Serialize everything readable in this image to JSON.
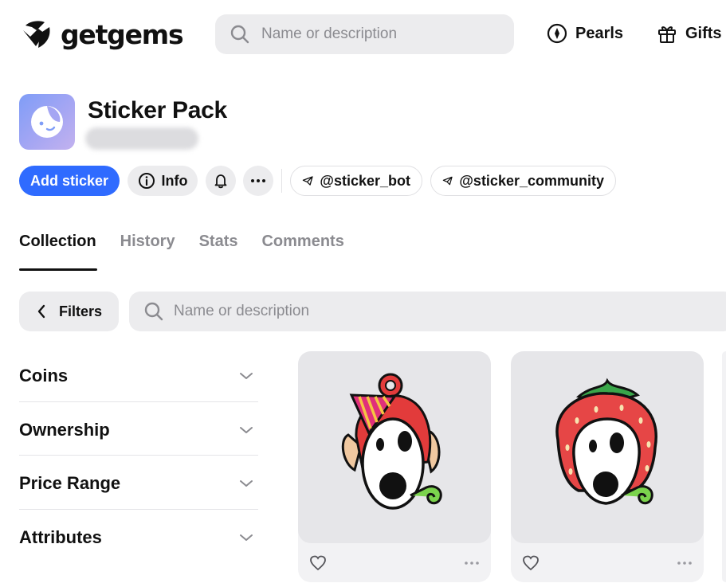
{
  "header": {
    "logo_text": "getgems",
    "search_placeholder": "Name or description",
    "nav": [
      {
        "label": "Pearls",
        "icon": "pearl-icon"
      },
      {
        "label": "Gifts",
        "icon": "gift-icon"
      }
    ]
  },
  "collection": {
    "title": "Sticker Pack",
    "avatar_colors": [
      "#7f9df7",
      "#c3b2ef"
    ]
  },
  "actions": {
    "add_label": "Add sticker",
    "info_label": "Info",
    "links": [
      "@sticker_bot",
      "@sticker_community"
    ]
  },
  "tabs": [
    "Collection",
    "History",
    "Stats",
    "Comments"
  ],
  "active_tab": "Collection",
  "filters": {
    "button_label": "Filters",
    "search_placeholder": "Name or description",
    "sections": [
      "Coins",
      "Ownership",
      "Price Range",
      "Attributes"
    ]
  },
  "items": [
    {
      "sticker": "party-hat-sticker"
    },
    {
      "sticker": "strawberry-helmet-sticker"
    }
  ],
  "colors": {
    "accent": "#2f6bff",
    "surface": "#ececee",
    "muted_text": "#8b8b90"
  }
}
